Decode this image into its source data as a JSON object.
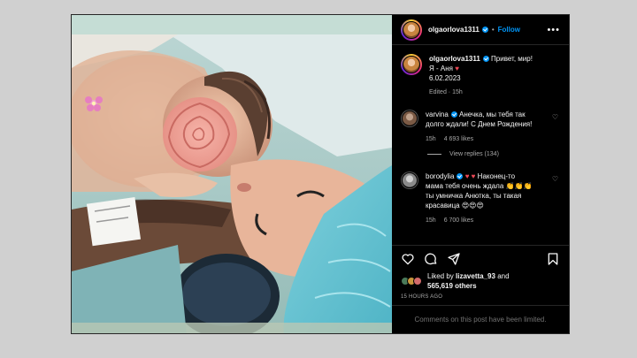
{
  "post": {
    "username": "olgaorlova1311",
    "follow_label": "Follow",
    "separator": "•",
    "more_label": "•••",
    "caption": {
      "username": "olgaorlova1311",
      "line1": "Привет, мир!",
      "line2": "Я - Аня",
      "line3": "6.02.2023",
      "edited": "Edited · 15h"
    },
    "comments": [
      {
        "username": "varvina",
        "text_lines": [
          "Анечка, мы тебя так",
          "долго ждали! С Днем Рождения!"
        ],
        "time": "15h",
        "likes": "4 693 likes",
        "view_replies": "View replies (134)"
      },
      {
        "username": "borodylia",
        "text_lines": [
          "Наконец-то",
          "мама тебя очень ждала",
          "ты умничка Анютка, ты такая",
          "красавица"
        ],
        "time": "15h",
        "likes": "6 700 likes"
      }
    ],
    "liked_by_prefix": "Liked by",
    "liked_by_user": "lizavetta_93",
    "liked_by_and": "and",
    "liked_by_count": "565,619 others",
    "time_ago": "15 HOURS AGO",
    "comments_limited": "Comments on this post have been limited."
  },
  "colors": {
    "accent_blue": "#0095f6",
    "heart_red": "#ed4956",
    "panel_bg": "#000000",
    "muted_text": "#a8a8a8"
  },
  "icons": [
    "heart-icon",
    "comment-icon",
    "share-icon",
    "bookmark-icon",
    "more-icon",
    "verified-icon",
    "heart-small-icon",
    "emoji-icon"
  ]
}
